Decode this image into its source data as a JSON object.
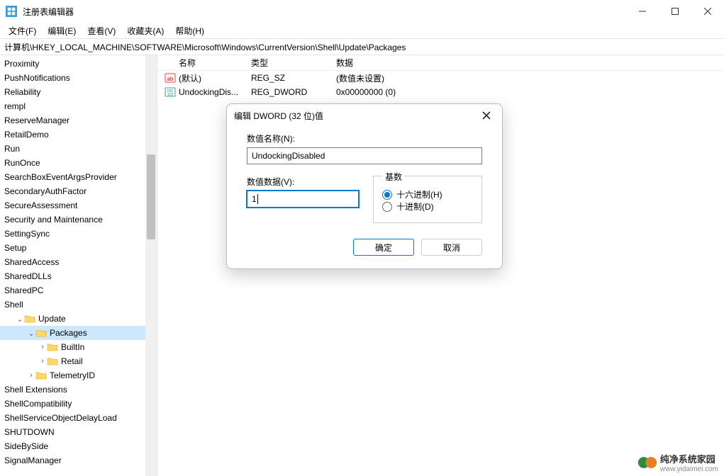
{
  "titlebar": {
    "title": "注册表编辑器"
  },
  "menu": {
    "file": "文件(F)",
    "edit": "编辑(E)",
    "view": "查看(V)",
    "favorites": "收藏夹(A)",
    "help": "帮助(H)"
  },
  "address": "计算机\\HKEY_LOCAL_MACHINE\\SOFTWARE\\Microsoft\\Windows\\CurrentVersion\\Shell\\Update\\Packages",
  "tree": {
    "items": [
      {
        "label": "Proximity",
        "indent": 0
      },
      {
        "label": "PushNotifications",
        "indent": 0
      },
      {
        "label": "Reliability",
        "indent": 0
      },
      {
        "label": "rempl",
        "indent": 0
      },
      {
        "label": "ReserveManager",
        "indent": 0
      },
      {
        "label": "RetailDemo",
        "indent": 0
      },
      {
        "label": "Run",
        "indent": 0
      },
      {
        "label": "RunOnce",
        "indent": 0
      },
      {
        "label": "SearchBoxEventArgsProvider",
        "indent": 0
      },
      {
        "label": "SecondaryAuthFactor",
        "indent": 0
      },
      {
        "label": "SecureAssessment",
        "indent": 0
      },
      {
        "label": "Security and Maintenance",
        "indent": 0
      },
      {
        "label": "SettingSync",
        "indent": 0
      },
      {
        "label": "Setup",
        "indent": 0
      },
      {
        "label": "SharedAccess",
        "indent": 0
      },
      {
        "label": "SharedDLLs",
        "indent": 0
      },
      {
        "label": "SharedPC",
        "indent": 0
      },
      {
        "label": "Shell",
        "indent": 0
      },
      {
        "label": "Update",
        "indent": 1,
        "folder": true,
        "expanded": true
      },
      {
        "label": "Packages",
        "indent": 2,
        "folder": true,
        "expanded": true,
        "selected": true
      },
      {
        "label": "BuiltIn",
        "indent": 3,
        "folder": true
      },
      {
        "label": "Retail",
        "indent": 3,
        "folder": true
      },
      {
        "label": "TelemetryID",
        "indent": 2,
        "folder": true
      },
      {
        "label": "Shell Extensions",
        "indent": 0
      },
      {
        "label": "ShellCompatibility",
        "indent": 0
      },
      {
        "label": "ShellServiceObjectDelayLoad",
        "indent": 0
      },
      {
        "label": "SHUTDOWN",
        "indent": 0
      },
      {
        "label": "SideBySide",
        "indent": 0
      },
      {
        "label": "SignalManager",
        "indent": 0
      }
    ]
  },
  "list": {
    "headers": {
      "name": "名称",
      "type": "类型",
      "data": "数据"
    },
    "rows": [
      {
        "icon": "string",
        "name": "(默认)",
        "type": "REG_SZ",
        "data": "(数值未设置)"
      },
      {
        "icon": "dword",
        "name": "UndockingDis...",
        "type": "REG_DWORD",
        "data": "0x00000000 (0)"
      }
    ]
  },
  "dialog": {
    "title": "编辑 DWORD (32 位)值",
    "nameLabel": "数值名称(N):",
    "nameValue": "UndockingDisabled",
    "dataLabel": "数值数据(V):",
    "dataValue": "1",
    "baseLabel": "基数",
    "hexLabel": "十六进制(H)",
    "decLabel": "十进制(D)",
    "ok": "确定",
    "cancel": "取消"
  },
  "watermark": {
    "line1": "纯净系统家园",
    "line2": "www.yidaimei.com"
  }
}
